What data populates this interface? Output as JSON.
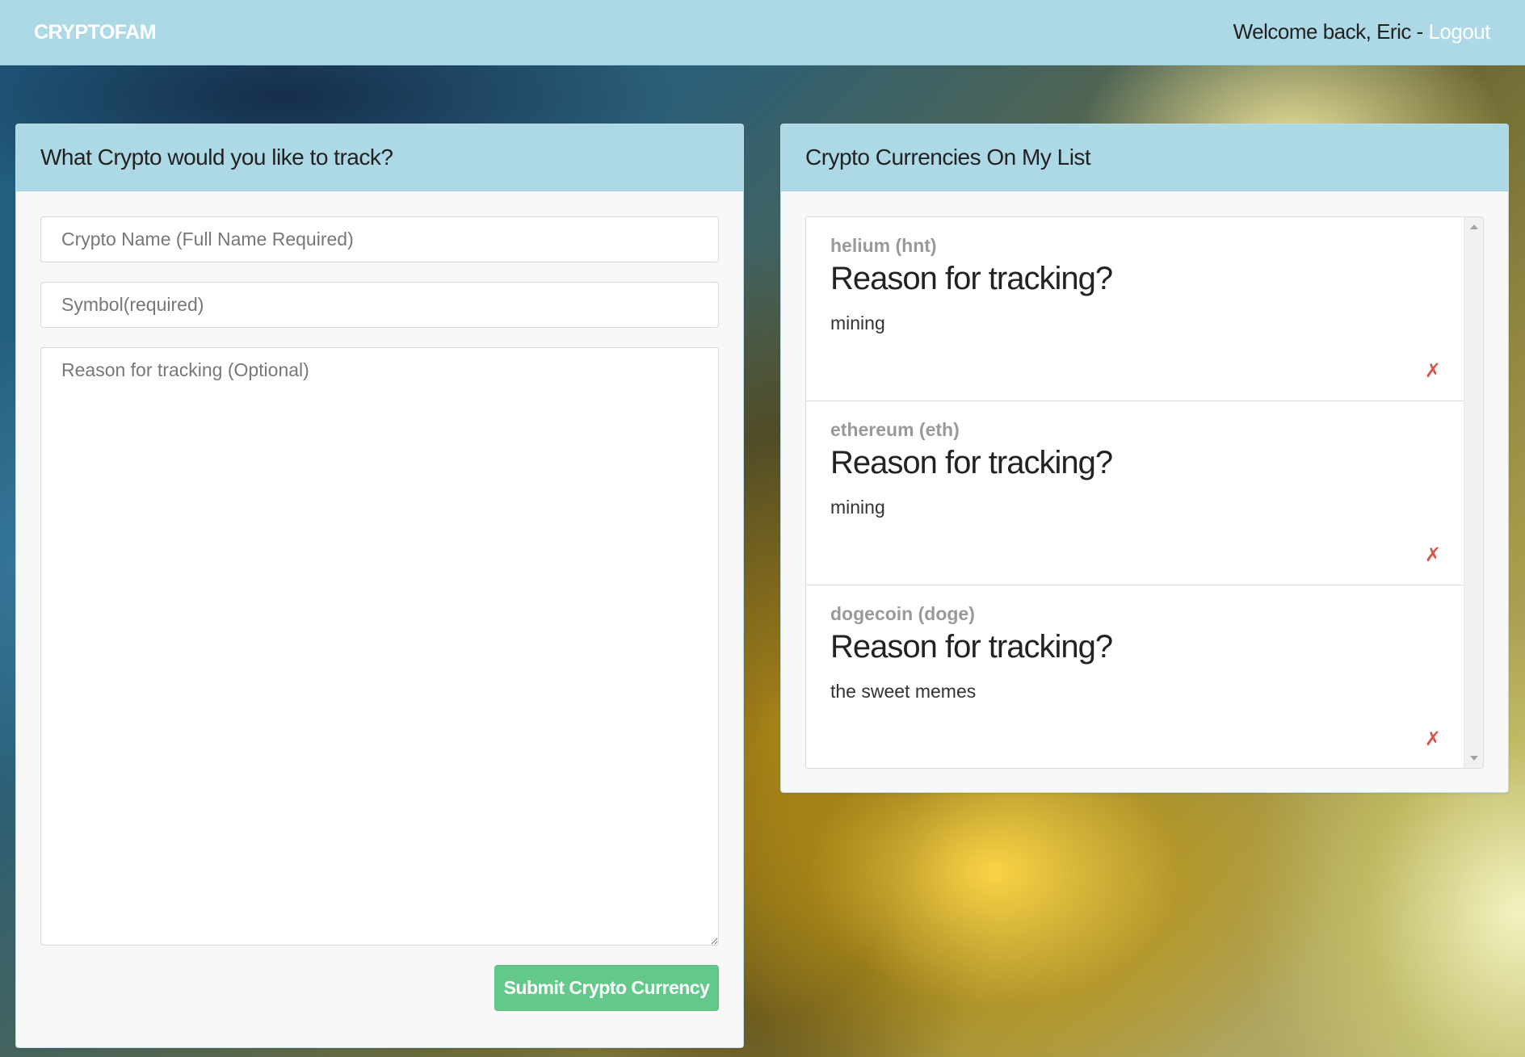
{
  "navbar": {
    "brand": "CRYPTOFAM",
    "welcome_text": "Welcome back, Eric - ",
    "logout_label": "Logout"
  },
  "add_form": {
    "title": "What Crypto would you like to track?",
    "name_placeholder": "Crypto Name (Full Name Required)",
    "symbol_placeholder": "Symbol(required)",
    "reason_placeholder": "Reason for tracking (Optional)",
    "submit_label": "Submit Crypto Currency"
  },
  "list_panel": {
    "title": "Crypto Currencies On My List",
    "items": [
      {
        "name": "helium (hnt)",
        "heading": "Reason for tracking?",
        "reason": "mining",
        "delete_label": "✗"
      },
      {
        "name": "ethereum (eth)",
        "heading": "Reason for tracking?",
        "reason": "mining",
        "delete_label": "✗"
      },
      {
        "name": "dogecoin (doge)",
        "heading": "Reason for tracking?",
        "reason": "the sweet memes",
        "delete_label": "✗"
      }
    ]
  },
  "colors": {
    "navbar_bg": "#add8e6",
    "submit_bg": "#62c98a",
    "delete": "#d9534f"
  }
}
